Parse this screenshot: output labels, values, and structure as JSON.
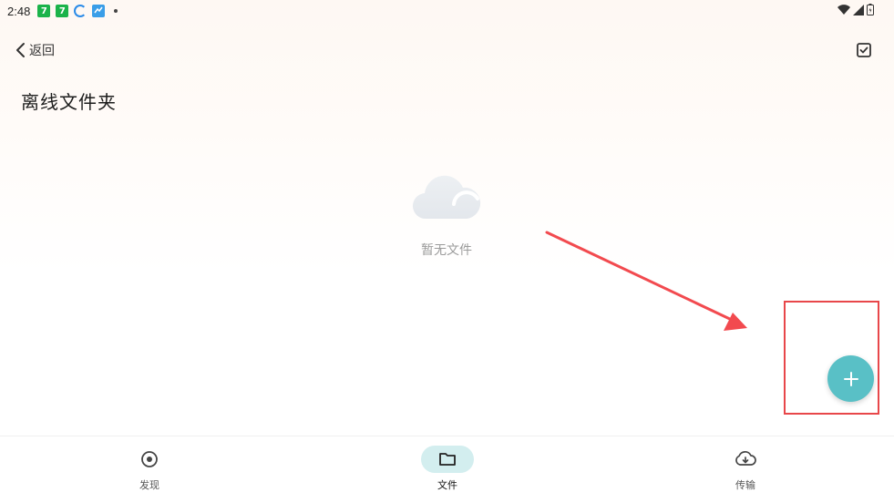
{
  "status_bar": {
    "time": "2:48",
    "icons": [
      "app-badge-7",
      "app-badge-7",
      "loading-ring-icon",
      "app-badge-blue",
      "notification-dot-icon"
    ],
    "right_icons": [
      "wifi-icon",
      "signal-icon",
      "battery-icon"
    ]
  },
  "header": {
    "back_label": "返回",
    "select_icon": "checkbox-icon"
  },
  "page": {
    "title": "离线文件夹"
  },
  "empty_state": {
    "icon": "cloud-icon",
    "text": "暂无文件"
  },
  "fab": {
    "icon": "plus-icon"
  },
  "annotation": {
    "color": "#e8474a"
  },
  "bottom_nav": {
    "items": [
      {
        "label": "发现",
        "icon": "discover-icon",
        "active": false
      },
      {
        "label": "文件",
        "icon": "folder-icon",
        "active": true
      },
      {
        "label": "传输",
        "icon": "cloud-download-icon",
        "active": false
      }
    ],
    "accent": "#59c0c6"
  }
}
